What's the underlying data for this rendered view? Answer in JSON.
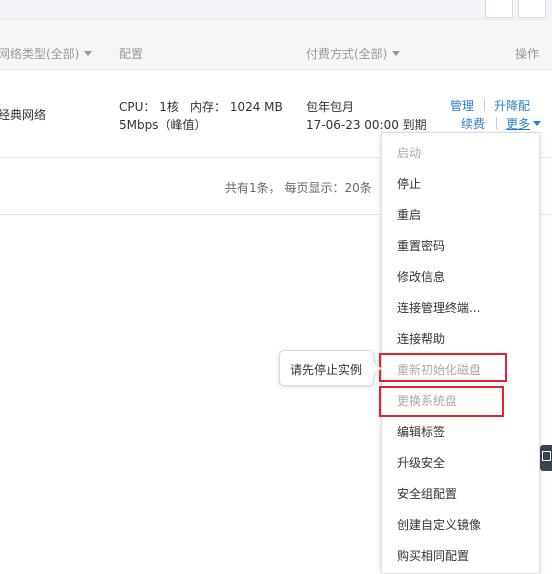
{
  "header": {
    "network_type": "网络类型(全部)",
    "config": "配置",
    "payment": "付费方式(全部)",
    "actions": "操作"
  },
  "row": {
    "network": "经典网络",
    "cpu": "CPU： 1核",
    "memory": "内存： 1024 MB",
    "bandwidth": "5Mbps（峰值）",
    "billing": "包年包月",
    "expiry": "17-06-23 00:00 到期",
    "actions": {
      "manage": "管理",
      "upgrade": "升降配",
      "renew": "续费",
      "more": "更多"
    }
  },
  "pagination": {
    "summary": "共有1条， 每页显示：20条"
  },
  "more_menu": {
    "items": [
      {
        "label": "启动",
        "disabled": true
      },
      {
        "label": "停止",
        "disabled": false
      },
      {
        "label": "重启",
        "disabled": false
      },
      {
        "label": "重置密码",
        "disabled": false
      },
      {
        "label": "修改信息",
        "disabled": false
      },
      {
        "label": "连接管理终端...",
        "disabled": false
      },
      {
        "label": "连接帮助",
        "disabled": false
      },
      {
        "label": "重新初始化磁盘",
        "disabled": true
      },
      {
        "label": "更换系统盘",
        "disabled": true
      },
      {
        "label": "编辑标签",
        "disabled": false
      },
      {
        "label": "升级安全",
        "disabled": false
      },
      {
        "label": "安全组配置",
        "disabled": false
      },
      {
        "label": "创建自定义镜像",
        "disabled": false
      },
      {
        "label": "购买相同配置",
        "disabled": false
      }
    ]
  },
  "tooltip": {
    "text": "请先停止实例"
  },
  "colors": {
    "link": "#2c7fd1",
    "highlight": "#e0262b",
    "disabled": "#aaaaaa"
  }
}
